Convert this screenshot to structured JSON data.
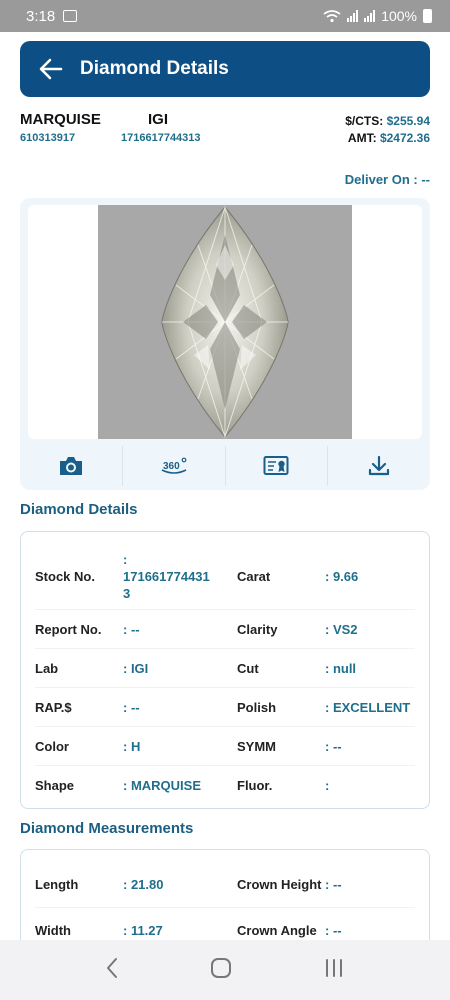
{
  "status": {
    "time": "3:18",
    "battery": "100%"
  },
  "header": {
    "title": "Diamond Details"
  },
  "summary": {
    "shape": "MARQUISE",
    "stock_no": "610313917",
    "lab": "IGI",
    "report_no": "1716617744313",
    "price_label": "$/CTS:",
    "price_value": "$255.94",
    "amt_label": "AMT:",
    "amt_value": "$2472.36"
  },
  "deliver": {
    "label": "Deliver On : --"
  },
  "media": {
    "icons": [
      "camera-icon",
      "360-view-icon",
      "certificate-icon",
      "download-icon"
    ]
  },
  "details": {
    "title": "Diamond Details",
    "rows": [
      {
        "k1": "Stock No.",
        "v1a": ":",
        "v1b": "1716617744313",
        "k2": "Carat",
        "v2": ": 9.66"
      },
      {
        "k1": "Report No.",
        "v1": ": --",
        "k2": "Clarity",
        "v2": ": VS2"
      },
      {
        "k1": "Lab",
        "v1": ": IGI",
        "k2": "Cut",
        "v2": ": null"
      },
      {
        "k1": "RAP.$",
        "v1": ": --",
        "k2": "Polish",
        "v2": ": EXCELLENT"
      },
      {
        "k1": "Color",
        "v1": ": H",
        "k2": "SYMM",
        "v2": ": --"
      },
      {
        "k1": "Shape",
        "v1": ": MARQUISE",
        "k2": "Fluor.",
        "v2": ":"
      }
    ]
  },
  "measurements": {
    "title": "Diamond Measurements",
    "rows": [
      {
        "k1": "Length",
        "v1": ": 21.80",
        "k2": "Crown Height",
        "v2": ": --"
      },
      {
        "k1": "Width",
        "v1": ": 11.27",
        "k2": "Crown Angle",
        "v2": ": --"
      }
    ]
  }
}
